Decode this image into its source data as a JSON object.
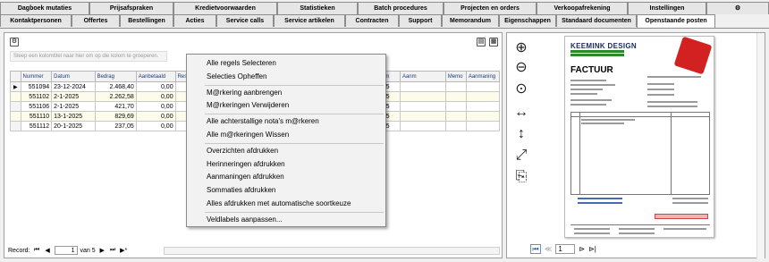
{
  "tabs_row1": [
    {
      "label": "Dagboek mutaties",
      "w": 100
    },
    {
      "label": "Prijsafspraken",
      "w": 94
    },
    {
      "label": "Kredietvoorwaarden",
      "w": 116
    },
    {
      "label": "Statistieken",
      "w": 90
    },
    {
      "label": "Batch procedures",
      "w": 96
    },
    {
      "label": "Projecten en orders",
      "w": 104
    },
    {
      "label": "Verkoopafrekening",
      "w": 102
    },
    {
      "label": "Instellingen",
      "w": 88
    },
    {
      "label": "",
      "w": 70
    }
  ],
  "tabs_row2": [
    {
      "label": "Kontaktpersonen",
      "w": 80
    },
    {
      "label": "Offertes",
      "w": 54
    },
    {
      "label": "Bestellingen",
      "w": 60
    },
    {
      "label": "Acties",
      "w": 48
    },
    {
      "label": "Service calls",
      "w": 64
    },
    {
      "label": "Service artikelen",
      "w": 80
    },
    {
      "label": "Contracten",
      "w": 60
    },
    {
      "label": "Support",
      "w": 48
    },
    {
      "label": "Memorandum",
      "w": 64
    },
    {
      "label": "Eigenschappen",
      "w": 64
    },
    {
      "label": "Standaard documenten",
      "w": 90
    },
    {
      "label": "Openstaande posten",
      "w": 88
    }
  ],
  "group_hint": "Sleep een kolomtitel naar hier om op die kolom te groeperen.",
  "grid": {
    "columns": [
      "",
      "Nummer",
      "Datum",
      "Bedrag",
      "Aanbetaald",
      "Restant",
      "",
      "",
      "",
      "",
      "",
      "",
      "",
      "",
      "",
      "",
      "",
      "Datum",
      "Aanm",
      "Memo",
      "Aanmaning"
    ],
    "rows": [
      {
        "indicator": "▶",
        "nummer": "551094",
        "datum": "23-12-2024",
        "bedrag": "2.468,40",
        "aanbetaald": "0,00",
        "restant": "2.468",
        "datum2": "-2025"
      },
      {
        "indicator": "",
        "nummer": "551102",
        "datum": "2-1-2025",
        "bedrag": "2.262,58",
        "aanbetaald": "0,00",
        "restant": "2.262,",
        "datum2": "-2025"
      },
      {
        "indicator": "",
        "nummer": "551106",
        "datum": "2-1-2025",
        "bedrag": "421,70",
        "aanbetaald": "0,00",
        "restant": "421",
        "datum2": "-2025"
      },
      {
        "indicator": "",
        "nummer": "551110",
        "datum": "13-1-2025",
        "bedrag": "829,69",
        "aanbetaald": "0,00",
        "restant": "829",
        "datum2": "-2025"
      },
      {
        "indicator": "",
        "nummer": "551112",
        "datum": "20-1-2025",
        "bedrag": "237,05",
        "aanbetaald": "0,00",
        "restant": "237",
        "datum2": "-2025"
      }
    ]
  },
  "navigator": {
    "label": "Record:",
    "current": "1",
    "of": "van 5"
  },
  "context_menu": [
    "Alle regels Selecteren",
    "Selecties Opheffen",
    "|",
    "M@rkering aanbrengen",
    "M@rkeringen Verwijderen",
    "|",
    "Alle achterstallige nota's m@rkeren",
    "Alle m@rkeringen Wissen",
    "|",
    "Overzichten afdrukken",
    "Herinneringen afdrukken",
    "Aanmaningen afdrukken",
    "Sommaties afdrukken",
    "Alles afdrukken met automatische soortkeuze",
    "|",
    "Veldlabels aanpassen..."
  ],
  "preview": {
    "logo": "KEEMINK DESIGN",
    "title": "FACTUUR",
    "page": "1",
    "tools": [
      "zoom-in-icon",
      "zoom-out-icon",
      "zoom-actual-icon",
      "fit-width-icon",
      "fit-height-icon",
      "fit-page-icon",
      "export-icon"
    ]
  }
}
